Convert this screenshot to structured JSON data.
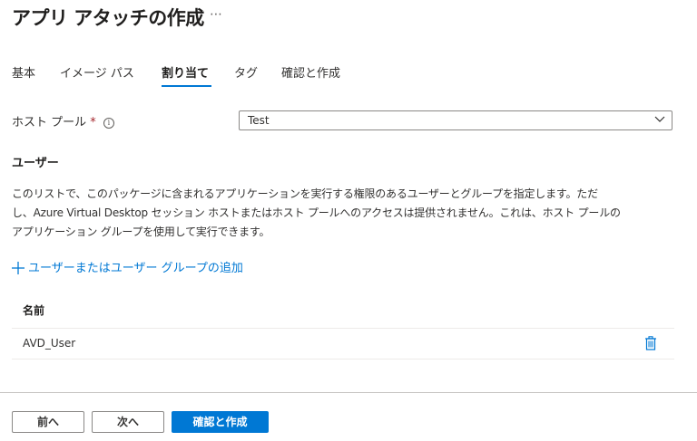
{
  "header": {
    "title": "アプリ アタッチの作成",
    "more": "⋯"
  },
  "tabs": [
    {
      "label": "基本",
      "active": false
    },
    {
      "label": "イメージ パス",
      "active": false
    },
    {
      "label": "割り当て",
      "active": true
    },
    {
      "label": "タグ",
      "active": false
    },
    {
      "label": "確認と作成",
      "active": false
    }
  ],
  "host_pool": {
    "label": "ホスト プール",
    "required_mark": "*",
    "info_icon": "info-icon",
    "value": "Test"
  },
  "users_section": {
    "heading": "ユーザー",
    "description": [
      "このリストで、このパッケージに含まれるアプリケーションを実行する権限のあるユーザーとグループを指定します。ただ",
      "し、Azure Virtual Desktop セッション ホストまたはホスト プールへのアクセスは提供されません。これは、ホスト プールの",
      "アプリケーション グループを使用して実行できます。"
    ],
    "add_link": "ユーザーまたはユーザー グループの追加"
  },
  "table": {
    "columns": [
      "名前"
    ],
    "rows": [
      {
        "name": "AVD_User",
        "action_icon": "trash-icon"
      }
    ]
  },
  "footer": {
    "prev_label": "前へ",
    "next_label": "次へ",
    "create_label": "確認と作成"
  },
  "colors": {
    "accent": "#0078d4",
    "required": "#a4262c"
  }
}
